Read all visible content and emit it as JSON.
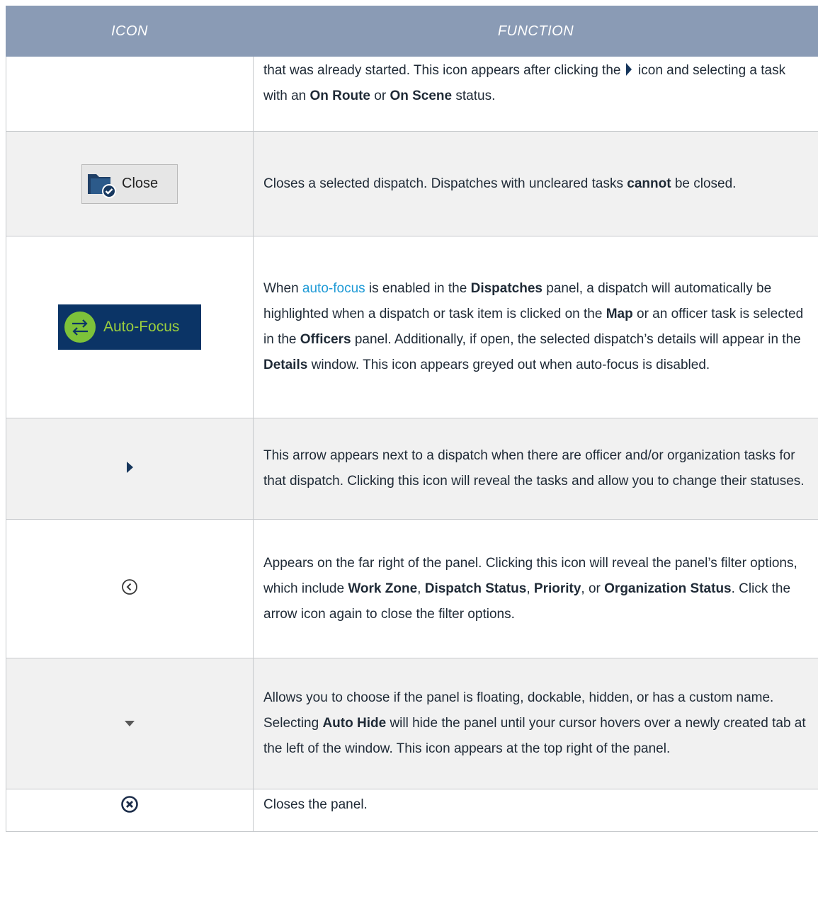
{
  "header": {
    "icon_col": "ICON",
    "function_col": "FUNCTION"
  },
  "rows": [
    {
      "icon": "none",
      "func_part1": "that was already started. This icon appears after clicking the ",
      "func_part2": " icon and selecting a task with an ",
      "bold1": "On Route",
      "func_part3": " or ",
      "bold2": "On Scene",
      "func_part4": " status."
    },
    {
      "icon": "folder-check-icon",
      "button_label": "Close",
      "func_part1": "Closes a selected dispatch. Dispatches with uncleared tasks ",
      "bold1": "cannot",
      "func_part2": " be closed."
    },
    {
      "icon": "auto-focus-icon",
      "button_label": "Auto-Focus",
      "func_part1": "When ",
      "link": "auto-focus",
      "func_part2": " is enabled in the ",
      "bold1": "Dispatches",
      "func_part3": " panel, a dispatch will automatically be highlighted when a dispatch or task item is clicked on the ",
      "bold2": "Map",
      "func_part4": " or an officer task is selected in the ",
      "bold3": "Officers",
      "func_part5": " panel. Additionally, if open, the selected dispatch’s details will appear in the ",
      "bold4": "Details",
      "func_part6": " window. This icon appears greyed out when auto-focus is disabled."
    },
    {
      "icon": "expand-arrow-icon",
      "func_part1": "This arrow appears next to a dispatch when there are officer and/or organization tasks for that dispatch. Clicking this icon will reveal the tasks and allow you to change their statuses."
    },
    {
      "icon": "chevron-left-circle-icon",
      "func_part1": "Appears on the far right of the panel. Clicking this icon will reveal the panel’s filter options, which include ",
      "bold1": "Work Zone",
      "func_part2": ", ",
      "bold2": "Dispatch Status",
      "func_part3": ", ",
      "bold3": "Priority",
      "func_part4": ", or ",
      "bold4": "Organization Status",
      "func_part5": ". Click the arrow icon again to close the filter options."
    },
    {
      "icon": "dropdown-arrow-icon",
      "func_part1": "Allows you to choose if the panel is floating, dockable, hidden, or has a custom name. Selecting ",
      "bold1": "Auto Hide",
      "func_part2": " will hide the panel until your cursor hovers over a newly created tab at the left of the window. This icon appears at the top right of the panel."
    },
    {
      "icon": "close-circle-icon",
      "func_part1": "Closes the panel."
    }
  ]
}
